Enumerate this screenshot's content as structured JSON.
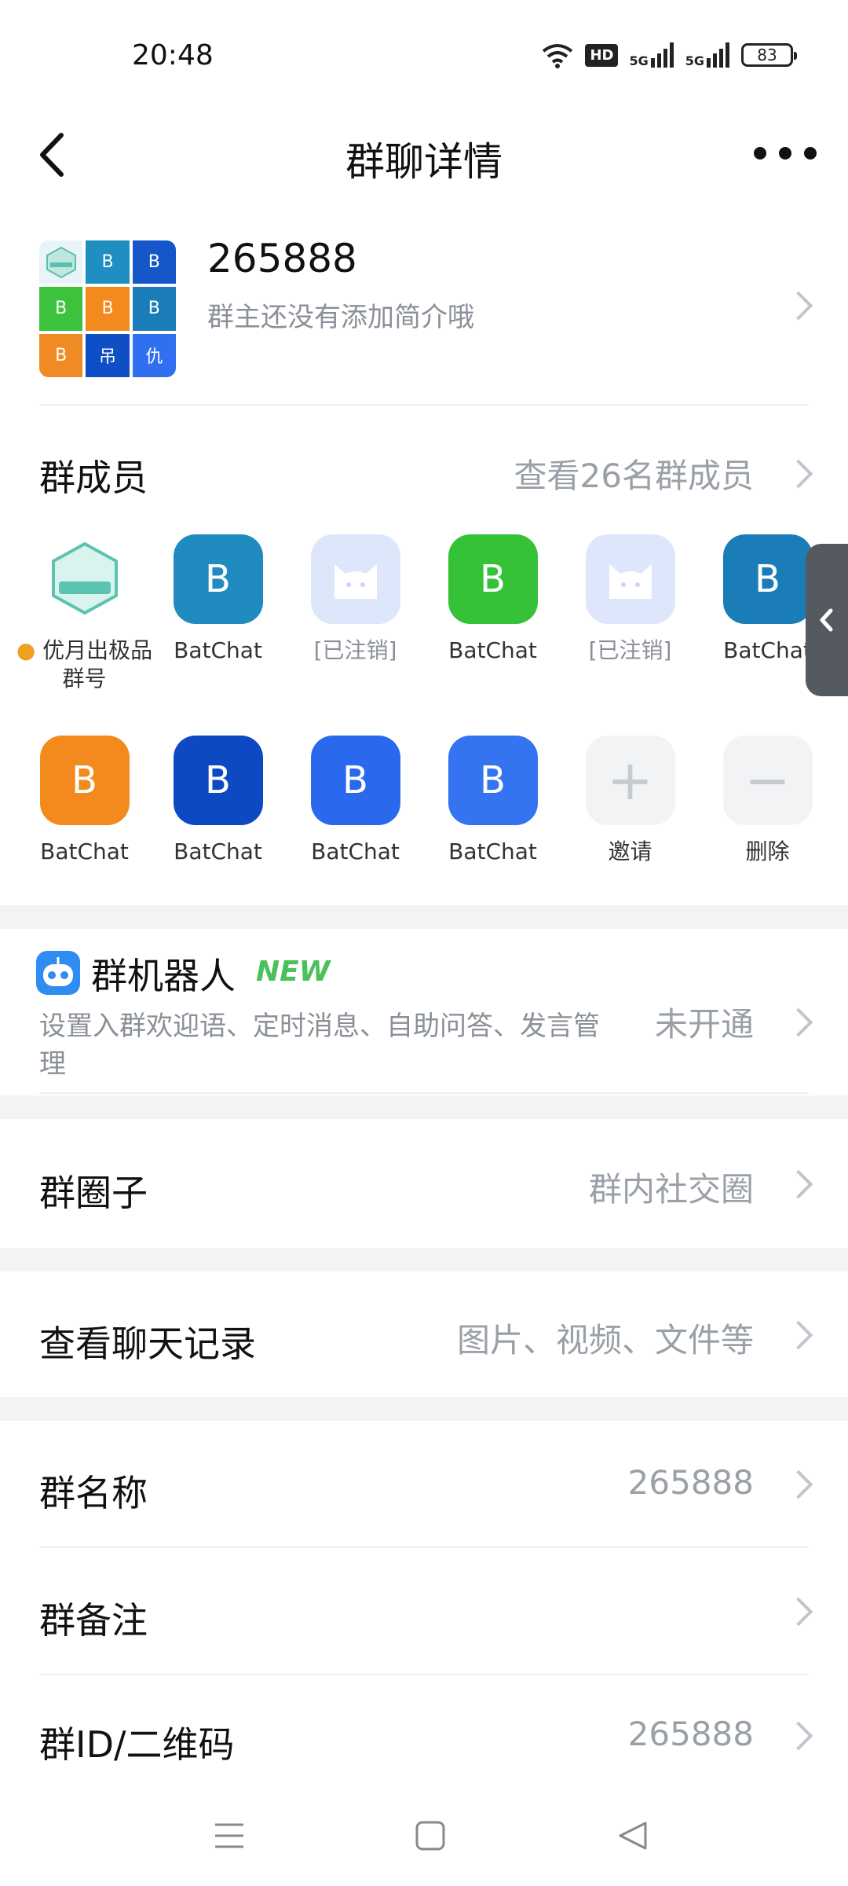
{
  "status_bar": {
    "time": "20:48",
    "hd_label": "HD",
    "net1": "5G",
    "net2": "5G",
    "battery": "83"
  },
  "navbar": {
    "title": "群聊详情"
  },
  "group": {
    "name": "265888",
    "intro": "群主还没有添加简介哦",
    "avatar_tiles": [
      {
        "label": "",
        "color": "#e8f4f8"
      },
      {
        "label": "B",
        "color": "#1e8fc0"
      },
      {
        "label": "B",
        "color": "#1556c8"
      },
      {
        "label": "B",
        "color": "#3cc23c"
      },
      {
        "label": "B",
        "color": "#f28a1e"
      },
      {
        "label": "B",
        "color": "#1a7db8"
      },
      {
        "label": "B",
        "color": "#f08a24"
      },
      {
        "label": "吊",
        "color": "#0f4fc6"
      },
      {
        "label": "仇",
        "color": "#2f6ff0"
      }
    ]
  },
  "members_section": {
    "label": "群成员",
    "value": "查看26名群成员"
  },
  "members": [
    {
      "name": "优月出极品群号",
      "letter": "",
      "color": "#ffffff",
      "gray": false,
      "owner": true
    },
    {
      "name": "BatChat",
      "letter": "B",
      "color": "#1f8bbf",
      "gray": false
    },
    {
      "name": "[已注销]",
      "letter": "",
      "color": "#dde6fb",
      "gray": true
    },
    {
      "name": "BatChat",
      "letter": "B",
      "color": "#35c238",
      "gray": false
    },
    {
      "name": "[已注销]",
      "letter": "",
      "color": "#dde6fb",
      "gray": true
    },
    {
      "name": "BatChat",
      "letter": "B",
      "color": "#1a7db8",
      "gray": false
    },
    {
      "name": "BatChat",
      "letter": "B",
      "color": "#f28a1e",
      "gray": false
    },
    {
      "name": "BatChat",
      "letter": "B",
      "color": "#0d49c2",
      "gray": false
    },
    {
      "name": "BatChat",
      "letter": "B",
      "color": "#2a68ee",
      "gray": false
    },
    {
      "name": "BatChat",
      "letter": "B",
      "color": "#3474f0",
      "gray": false
    },
    {
      "name": "邀请",
      "letter": "+",
      "color": "#f2f3f5",
      "gray": false,
      "action": "invite"
    },
    {
      "name": "删除",
      "letter": "−",
      "color": "#f2f3f5",
      "gray": false,
      "action": "remove"
    }
  ],
  "robot": {
    "label": "群机器人",
    "badge": "NEW",
    "desc": "设置入群欢迎语、定时消息、自助问答、发言管理",
    "value": "未开通"
  },
  "circle": {
    "label": "群圈子",
    "value": "群内社交圈"
  },
  "history": {
    "label": "查看聊天记录",
    "value": "图片、视频、文件等"
  },
  "group_name_row": {
    "label": "群名称",
    "value": "265888"
  },
  "group_remark_row": {
    "label": "群备注",
    "value": ""
  },
  "group_id_row": {
    "label": "群ID/二维码",
    "value": "265888"
  },
  "colors": {
    "accent_new": "#4cc05a",
    "gray_text": "#9aa0a8",
    "section_bg": "#f2f3f5"
  }
}
